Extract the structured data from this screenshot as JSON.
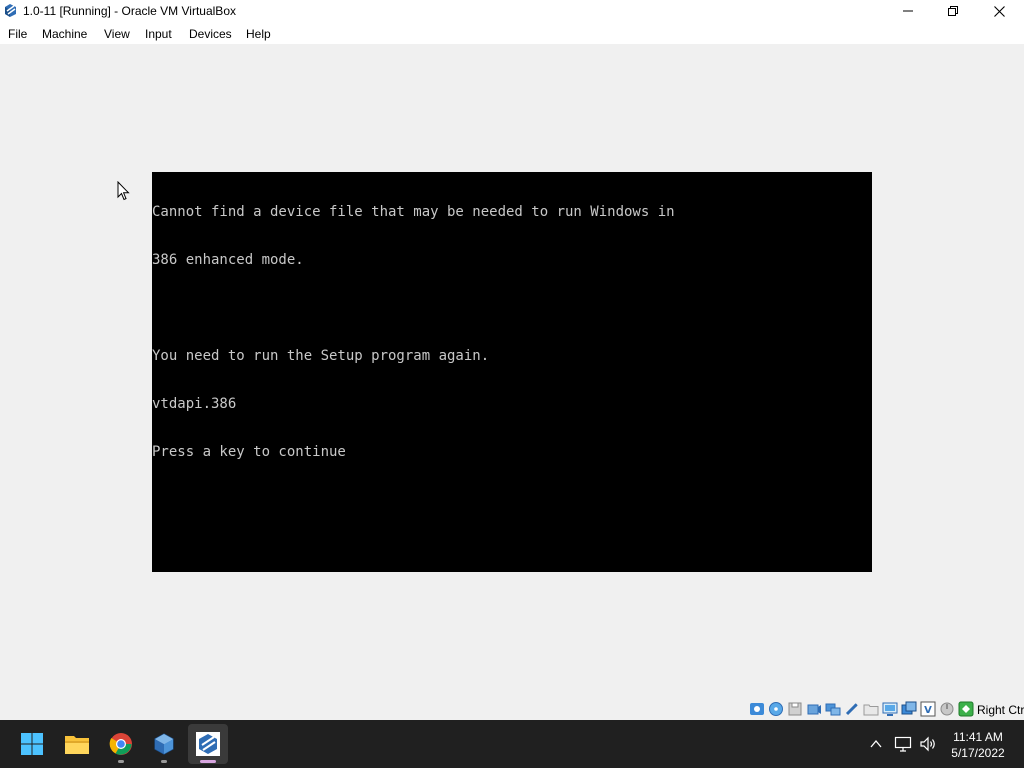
{
  "window": {
    "title": "1.0-11 [Running] - Oracle VM VirtualBox",
    "icon": "virtualbox-icon"
  },
  "menu": {
    "items": [
      "File",
      "Machine",
      "View",
      "Input",
      "Devices",
      "Help"
    ]
  },
  "console": {
    "lines": [
      "Cannot find a device file that may be needed to run Windows in",
      "386 enhanced mode.",
      "",
      "You need to run the Setup program again.",
      "vtdapi.386",
      "Press a key to continue"
    ]
  },
  "statusbar": {
    "icons": [
      "hard-disk-icon",
      "optical-drive-icon",
      "floppy-drive-icon",
      "audio-icon",
      "network-icon",
      "usb-icon",
      "shared-folders-icon",
      "display-icon",
      "recording-icon",
      "vt-x-icon",
      "mouse-integration-icon",
      "keyboard-capture-icon"
    ],
    "host_key_label": "Right Ctrl"
  },
  "taskbar": {
    "apps": [
      "windows-start-icon",
      "file-explorer-icon",
      "chrome-icon",
      "virtualbox-manager-icon",
      "virtualbox-vm-icon"
    ],
    "tray_icons": [
      "chevron-up-icon",
      "network-icon",
      "volume-icon"
    ],
    "time": "11:41 AM",
    "date": "5/17/2022"
  },
  "colors": {
    "console_background": "#000000",
    "console_text": "#c8c8c8",
    "taskbar_background": "#202020",
    "window_background": "#f0f0f0"
  }
}
